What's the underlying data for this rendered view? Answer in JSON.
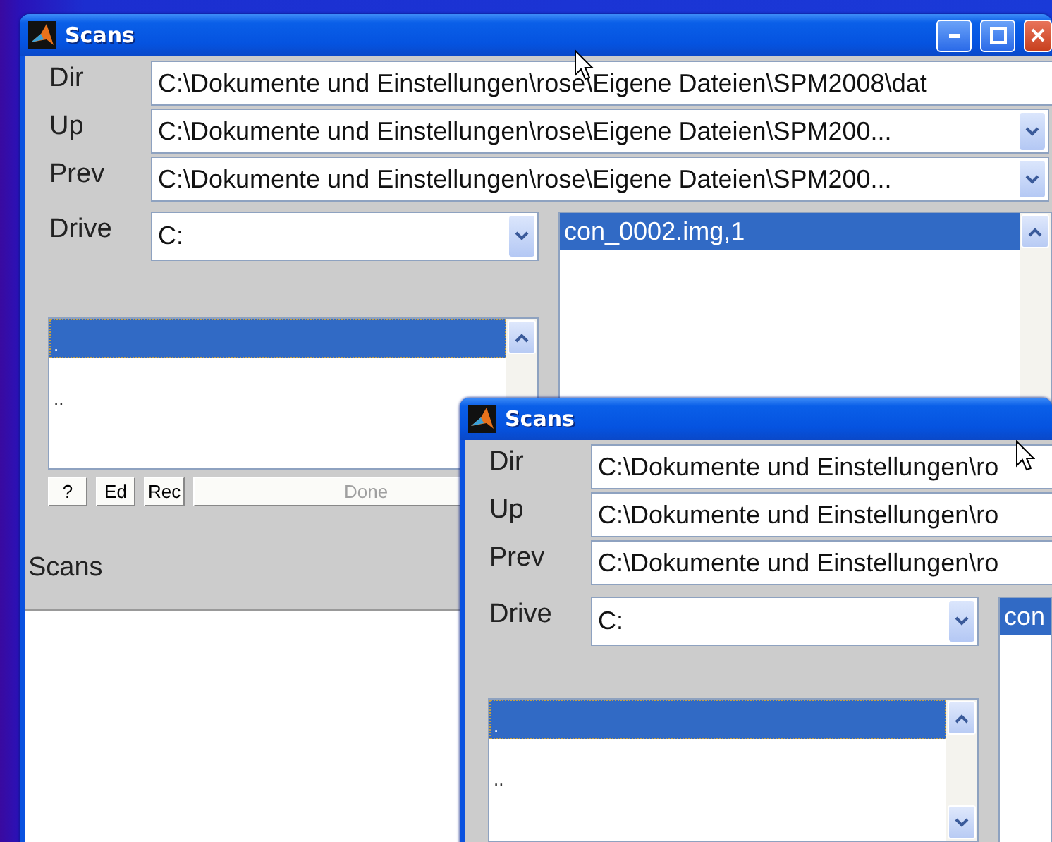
{
  "windows": [
    {
      "title": "Scans",
      "dir_label": "Dir",
      "dir": "C:\\Dokumente und Einstellungen\\rose\\Eigene Dateien\\SPM2008\\dat",
      "up_label": "Up",
      "up": "C:\\Dokumente und Einstellungen\\rose\\Eigene Dateien\\SPM200...",
      "prev_label": "Prev",
      "prev": "C:\\Dokumente und Einstellungen\\rose\\Eigene Dateien\\SPM200...",
      "drive_label": "Drive",
      "drive": "C:",
      "folders": [
        {
          "name": ".",
          "selected": true
        },
        {
          "name": "..",
          "selected": false
        }
      ],
      "files": [
        {
          "name": "con_0002.img,1",
          "selected": true
        }
      ],
      "buttons": [
        {
          "label": "?",
          "disabled": false
        },
        {
          "label": "Ed",
          "disabled": false
        },
        {
          "label": "Rec",
          "disabled": false
        },
        {
          "label": "Done",
          "disabled": true
        }
      ],
      "selection_label": "Scans"
    },
    {
      "title": "Scans",
      "dir_label": "Dir",
      "dir": "C:\\Dokumente und Einstellungen\\ro",
      "up_label": "Up",
      "up": "C:\\Dokumente und Einstellungen\\ro",
      "prev_label": "Prev",
      "prev": "C:\\Dokumente und Einstellungen\\ro",
      "drive_label": "Drive",
      "drive": "C:",
      "folders": [
        {
          "name": ".",
          "selected": true
        },
        {
          "name": "..",
          "selected": false
        }
      ],
      "files": [
        {
          "name": "con",
          "selected": true
        }
      ]
    }
  ]
}
